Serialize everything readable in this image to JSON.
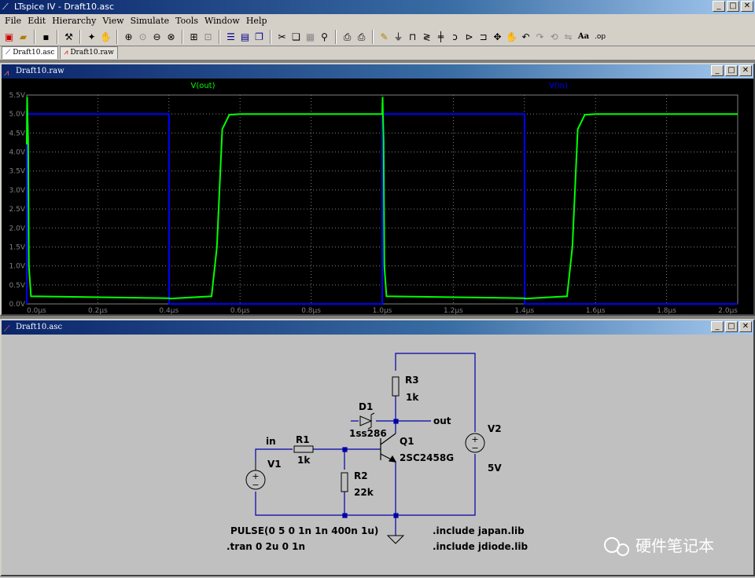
{
  "window": {
    "title": "LTspice IV - Draft10.asc"
  },
  "menu": [
    "File",
    "Edit",
    "Hierarchy",
    "View",
    "Simulate",
    "Tools",
    "Window",
    "Help"
  ],
  "toolbar_icons": [
    "new-schematic-icon",
    "open-icon",
    "save-icon",
    "control-panel-icon",
    "run-icon",
    "halt-icon",
    "zoom-in-icon",
    "zoom-pan-icon",
    "zoom-out-icon",
    "zoom-cancel-icon",
    "autorange-icon",
    "zoom-fit-icon",
    "tile-vertical-icon",
    "tile-horizontal-icon",
    "cascade-icon",
    "cut-icon",
    "copy-icon",
    "paste-icon",
    "find-icon",
    "print-setup-icon",
    "print-icon",
    "wire-icon",
    "ground-icon",
    "label-icon",
    "resistor-icon",
    "capacitor-icon",
    "inductor-icon",
    "diode-icon",
    "component-icon",
    "move-icon",
    "drag-icon",
    "undo-icon",
    "redo-icon",
    "rotate-icon",
    "mirror-icon",
    "text-icon",
    "spice-directive-icon"
  ],
  "toolbar_text": {
    "text": "Aa",
    "directive": ".op"
  },
  "tabs": [
    {
      "label": "Draft10.asc",
      "icon": "schematic-icon"
    },
    {
      "label": "Draft10.raw",
      "icon": "waveform-icon"
    }
  ],
  "plot_window": {
    "title": "Draft10.raw"
  },
  "schematic_window": {
    "title": "Draft10.asc"
  },
  "win_buttons": {
    "min": "_",
    "max": "□",
    "close": "✕"
  },
  "chart_data": {
    "type": "line",
    "xlabel": "",
    "ylabel": "",
    "xlim": [
      0,
      2.0
    ],
    "ylim": [
      0,
      5.5
    ],
    "x_ticks": [
      "0.0µs",
      "0.2µs",
      "0.4µs",
      "0.6µs",
      "0.8µs",
      "1.0µs",
      "1.2µs",
      "1.4µs",
      "1.6µs",
      "1.8µs",
      "2.0µs"
    ],
    "y_ticks": [
      "0.0V",
      "0.5V",
      "1.0V",
      "1.5V",
      "2.0V",
      "2.5V",
      "3.0V",
      "3.5V",
      "4.0V",
      "4.5V",
      "5.0V",
      "5.5V"
    ],
    "grid": true,
    "series": [
      {
        "name": "V(out)",
        "color": "#00ff00",
        "x": [
          0,
          0.001,
          0.002,
          0.004,
          0.006,
          0.012,
          0.4,
          0.402,
          0.52,
          0.535,
          0.55,
          0.57,
          0.6,
          1.0,
          1.001,
          1.002,
          1.004,
          1.006,
          1.012,
          1.4,
          1.402,
          1.52,
          1.535,
          1.55,
          1.57,
          1.6,
          2.0
        ],
        "y": [
          4.2,
          5.45,
          5.0,
          4.3,
          1.0,
          0.2,
          0.15,
          0.14,
          0.2,
          1.5,
          4.6,
          4.98,
          5.0,
          5.0,
          5.45,
          5.0,
          4.3,
          1.0,
          0.2,
          0.15,
          0.14,
          0.2,
          1.5,
          4.6,
          4.98,
          5.0,
          5.0
        ]
      },
      {
        "name": "V(in)",
        "color": "#0000ff",
        "x": [
          0,
          0.0005,
          0.4,
          0.4005,
          1.0,
          1.0005,
          1.4,
          1.4005,
          2.0
        ],
        "y": [
          0,
          5.0,
          5.0,
          0,
          0,
          5.0,
          5.0,
          0,
          0
        ]
      }
    ]
  },
  "schematic": {
    "net_in": "in",
    "net_out": "out",
    "components": {
      "V1": {
        "ref": "V1"
      },
      "V2": {
        "ref": "V2",
        "value": "5V"
      },
      "R1": {
        "ref": "R1",
        "value": "1k"
      },
      "R2": {
        "ref": "R2",
        "value": "22k"
      },
      "R3": {
        "ref": "R3",
        "value": "1k"
      },
      "D1": {
        "ref": "D1",
        "value": "1ss286"
      },
      "Q1": {
        "ref": "Q1",
        "value": "2SC2458G"
      }
    },
    "directives": {
      "pulse": "PULSE(0 5 0 1n 1n 400n 1u)",
      "tran": ".tran 0 2u 0 1n",
      "inc1": ".include japan.lib",
      "inc2": ".include jdiode.lib"
    },
    "watermark": "硬件笔记本"
  }
}
